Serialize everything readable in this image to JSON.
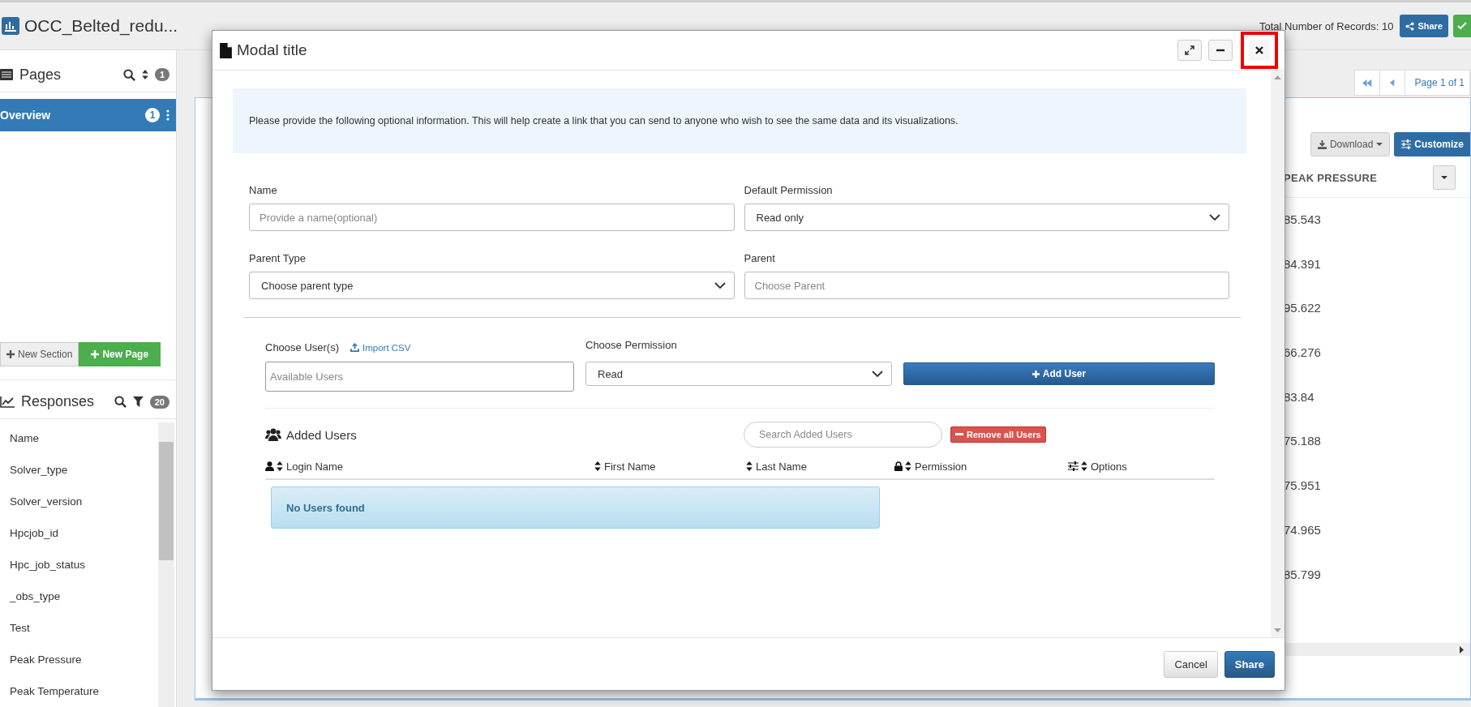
{
  "app": {
    "title": "OCC_Belted_redu...",
    "records": "Total Number of Records: 10",
    "share_button": "Share"
  },
  "pages_panel": {
    "title": "Pages",
    "count": "1",
    "items": [
      {
        "label": "Overview",
        "badge": "1",
        "selected": true
      }
    ],
    "buttons": [
      {
        "label": "New Section",
        "kind": "default"
      },
      {
        "label": "New Page",
        "kind": "success"
      }
    ]
  },
  "responses_panel": {
    "title": "Responses",
    "count": "20",
    "items": [
      "Name",
      "Solver_type",
      "Solver_version",
      "Hpcjob_id",
      "Hpc_job_status",
      "_obs_type",
      "Test",
      "Peak Pressure",
      "Peak Temperature"
    ]
  },
  "table": {
    "pagination": {
      "page_label": "Page 1 of 1"
    },
    "download_button": "Download",
    "customize_button": "Customize",
    "column": "PEAK PRESSURE",
    "values": [
      "85.543",
      "84.391",
      "95.622",
      "66.276",
      "83.84",
      "75.188",
      "75.951",
      "74.965",
      "85.799"
    ]
  },
  "modal": {
    "title": "Modal title",
    "window_buttons": [
      {
        "kind": "expand",
        "highlighted": false
      },
      {
        "kind": "minimize",
        "highlighted": false
      },
      {
        "kind": "close",
        "highlighted": true
      }
    ],
    "info": "Please provide the following optional information. This will help create a link that you can send to anyone who wish to see the same data and its visualizations.",
    "fields": [
      {
        "label": "Name",
        "kind": "text",
        "placeholder": "Provide a name(optional)"
      },
      {
        "label": "Default Permission",
        "kind": "select",
        "value": "Read only"
      },
      {
        "label": "Parent Type",
        "kind": "select",
        "value": "Choose parent type"
      },
      {
        "label": "Parent",
        "kind": "text",
        "placeholder": "Choose Parent"
      }
    ],
    "users": {
      "label": "Choose User(s)",
      "import_link": "Import CSV",
      "placeholder": "Available Users",
      "permission_label": "Choose Permission",
      "permission_value": "Read",
      "add_button": "Add User"
    },
    "added": {
      "title": "Added Users",
      "search_placeholder": "Search Added Users",
      "remove_button": "Remove all Users",
      "columns": [
        {
          "label": "Login Name",
          "kind": "user"
        },
        {
          "label": "First Name",
          "kind": "plain"
        },
        {
          "label": "Last Name",
          "kind": "plain"
        },
        {
          "label": "Permission",
          "kind": "lock"
        },
        {
          "label": "Options",
          "kind": "sliders"
        }
      ],
      "empty_message": "No Users found"
    },
    "buttons": [
      {
        "label": "Cancel",
        "kind": "default"
      },
      {
        "label": "Share",
        "kind": "primary"
      }
    ]
  }
}
